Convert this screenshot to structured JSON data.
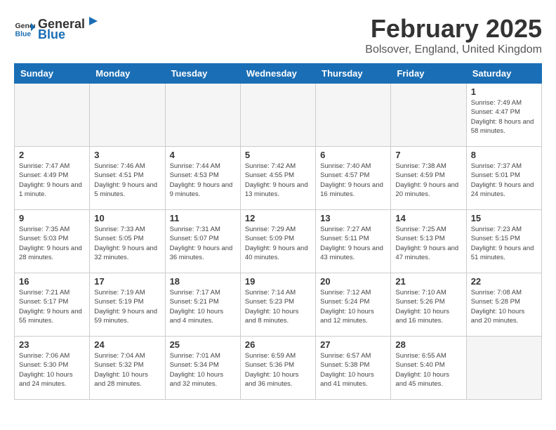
{
  "header": {
    "logo_general": "General",
    "logo_blue": "Blue",
    "month_year": "February 2025",
    "location": "Bolsover, England, United Kingdom"
  },
  "calendar": {
    "days_of_week": [
      "Sunday",
      "Monday",
      "Tuesday",
      "Wednesday",
      "Thursday",
      "Friday",
      "Saturday"
    ],
    "weeks": [
      [
        {
          "day": "",
          "info": ""
        },
        {
          "day": "",
          "info": ""
        },
        {
          "day": "",
          "info": ""
        },
        {
          "day": "",
          "info": ""
        },
        {
          "day": "",
          "info": ""
        },
        {
          "day": "",
          "info": ""
        },
        {
          "day": "1",
          "info": "Sunrise: 7:49 AM\nSunset: 4:47 PM\nDaylight: 8 hours and 58 minutes."
        }
      ],
      [
        {
          "day": "2",
          "info": "Sunrise: 7:47 AM\nSunset: 4:49 PM\nDaylight: 9 hours and 1 minute."
        },
        {
          "day": "3",
          "info": "Sunrise: 7:46 AM\nSunset: 4:51 PM\nDaylight: 9 hours and 5 minutes."
        },
        {
          "day": "4",
          "info": "Sunrise: 7:44 AM\nSunset: 4:53 PM\nDaylight: 9 hours and 9 minutes."
        },
        {
          "day": "5",
          "info": "Sunrise: 7:42 AM\nSunset: 4:55 PM\nDaylight: 9 hours and 13 minutes."
        },
        {
          "day": "6",
          "info": "Sunrise: 7:40 AM\nSunset: 4:57 PM\nDaylight: 9 hours and 16 minutes."
        },
        {
          "day": "7",
          "info": "Sunrise: 7:38 AM\nSunset: 4:59 PM\nDaylight: 9 hours and 20 minutes."
        },
        {
          "day": "8",
          "info": "Sunrise: 7:37 AM\nSunset: 5:01 PM\nDaylight: 9 hours and 24 minutes."
        }
      ],
      [
        {
          "day": "9",
          "info": "Sunrise: 7:35 AM\nSunset: 5:03 PM\nDaylight: 9 hours and 28 minutes."
        },
        {
          "day": "10",
          "info": "Sunrise: 7:33 AM\nSunset: 5:05 PM\nDaylight: 9 hours and 32 minutes."
        },
        {
          "day": "11",
          "info": "Sunrise: 7:31 AM\nSunset: 5:07 PM\nDaylight: 9 hours and 36 minutes."
        },
        {
          "day": "12",
          "info": "Sunrise: 7:29 AM\nSunset: 5:09 PM\nDaylight: 9 hours and 40 minutes."
        },
        {
          "day": "13",
          "info": "Sunrise: 7:27 AM\nSunset: 5:11 PM\nDaylight: 9 hours and 43 minutes."
        },
        {
          "day": "14",
          "info": "Sunrise: 7:25 AM\nSunset: 5:13 PM\nDaylight: 9 hours and 47 minutes."
        },
        {
          "day": "15",
          "info": "Sunrise: 7:23 AM\nSunset: 5:15 PM\nDaylight: 9 hours and 51 minutes."
        }
      ],
      [
        {
          "day": "16",
          "info": "Sunrise: 7:21 AM\nSunset: 5:17 PM\nDaylight: 9 hours and 55 minutes."
        },
        {
          "day": "17",
          "info": "Sunrise: 7:19 AM\nSunset: 5:19 PM\nDaylight: 9 hours and 59 minutes."
        },
        {
          "day": "18",
          "info": "Sunrise: 7:17 AM\nSunset: 5:21 PM\nDaylight: 10 hours and 4 minutes."
        },
        {
          "day": "19",
          "info": "Sunrise: 7:14 AM\nSunset: 5:23 PM\nDaylight: 10 hours and 8 minutes."
        },
        {
          "day": "20",
          "info": "Sunrise: 7:12 AM\nSunset: 5:24 PM\nDaylight: 10 hours and 12 minutes."
        },
        {
          "day": "21",
          "info": "Sunrise: 7:10 AM\nSunset: 5:26 PM\nDaylight: 10 hours and 16 minutes."
        },
        {
          "day": "22",
          "info": "Sunrise: 7:08 AM\nSunset: 5:28 PM\nDaylight: 10 hours and 20 minutes."
        }
      ],
      [
        {
          "day": "23",
          "info": "Sunrise: 7:06 AM\nSunset: 5:30 PM\nDaylight: 10 hours and 24 minutes."
        },
        {
          "day": "24",
          "info": "Sunrise: 7:04 AM\nSunset: 5:32 PM\nDaylight: 10 hours and 28 minutes."
        },
        {
          "day": "25",
          "info": "Sunrise: 7:01 AM\nSunset: 5:34 PM\nDaylight: 10 hours and 32 minutes."
        },
        {
          "day": "26",
          "info": "Sunrise: 6:59 AM\nSunset: 5:36 PM\nDaylight: 10 hours and 36 minutes."
        },
        {
          "day": "27",
          "info": "Sunrise: 6:57 AM\nSunset: 5:38 PM\nDaylight: 10 hours and 41 minutes."
        },
        {
          "day": "28",
          "info": "Sunrise: 6:55 AM\nSunset: 5:40 PM\nDaylight: 10 hours and 45 minutes."
        },
        {
          "day": "",
          "info": ""
        }
      ]
    ]
  }
}
